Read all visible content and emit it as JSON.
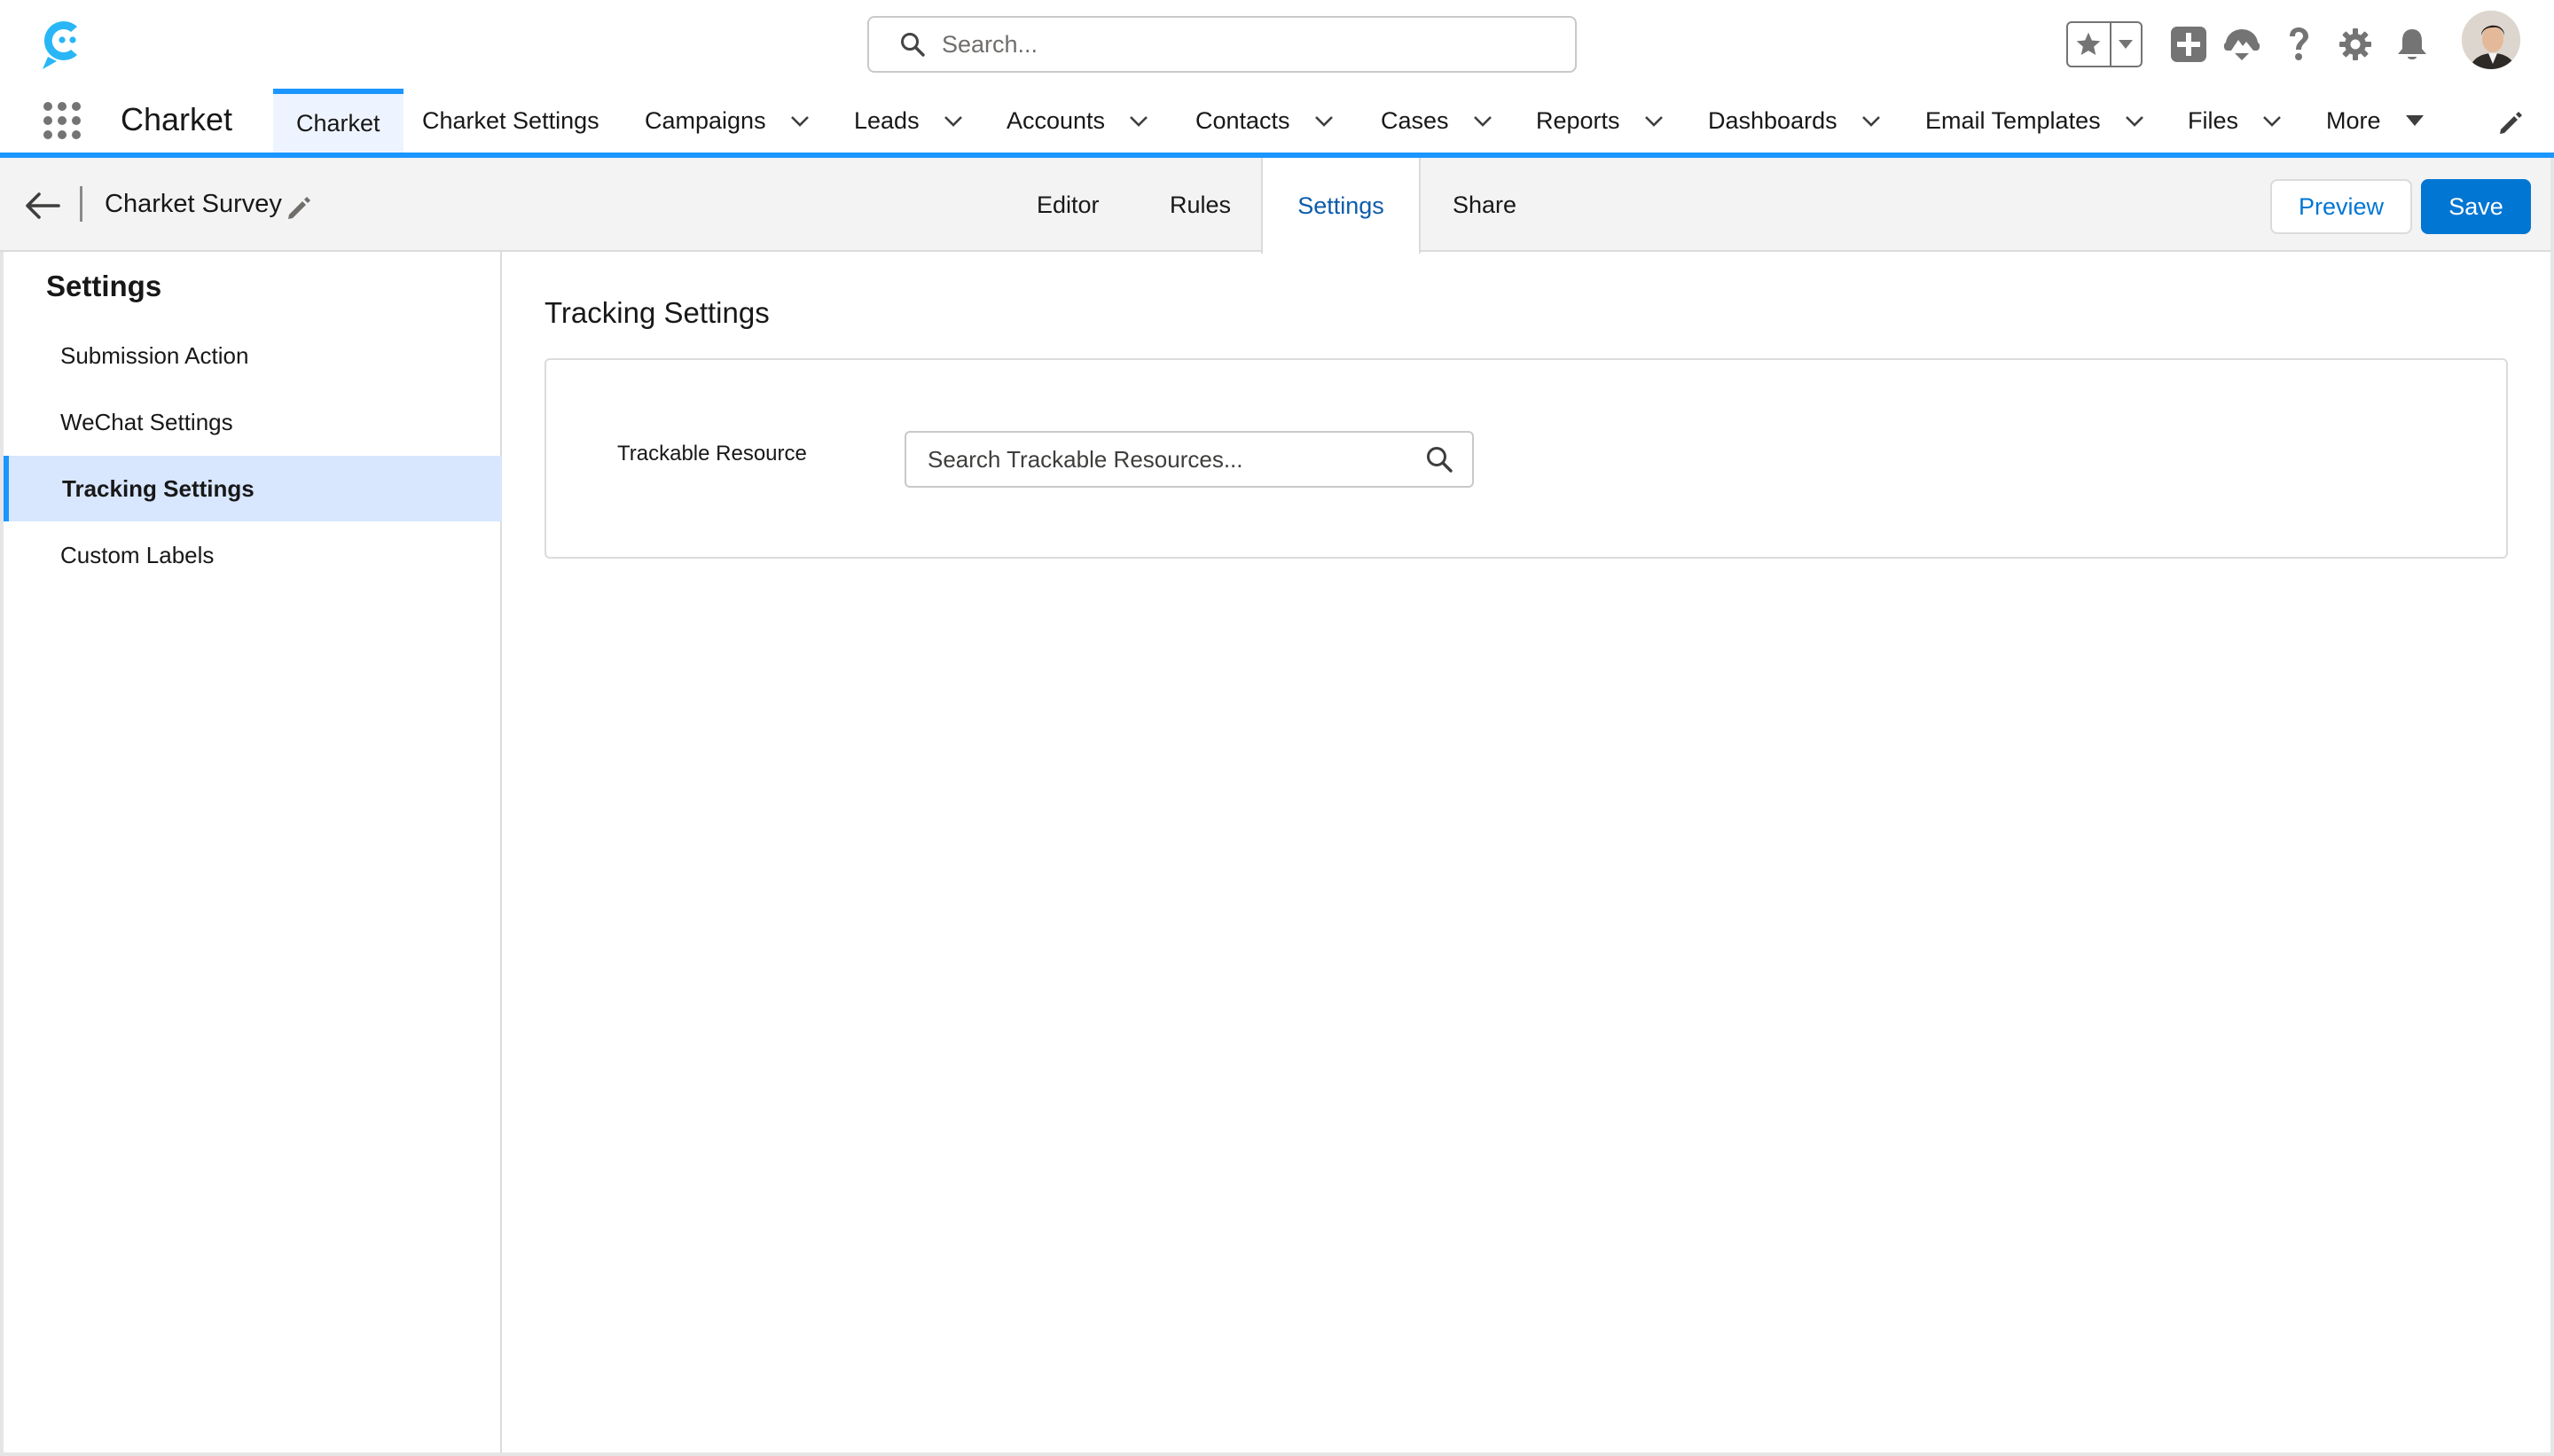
{
  "header": {
    "search_placeholder": "Search..."
  },
  "nav": {
    "app_name": "Charket",
    "items": [
      {
        "label": "Charket",
        "active": true
      },
      {
        "label": "Charket Settings"
      },
      {
        "label": "Campaigns"
      },
      {
        "label": "Leads"
      },
      {
        "label": "Accounts"
      },
      {
        "label": "Contacts"
      },
      {
        "label": "Cases"
      },
      {
        "label": "Reports"
      },
      {
        "label": "Dashboards"
      },
      {
        "label": "Email Templates"
      },
      {
        "label": "Files"
      },
      {
        "label": "More"
      }
    ]
  },
  "builder": {
    "survey_title": "Charket Survey",
    "tabs": [
      {
        "label": "Editor"
      },
      {
        "label": "Rules"
      },
      {
        "label": "Settings",
        "active": true
      },
      {
        "label": "Share"
      }
    ],
    "preview_label": "Preview",
    "save_label": "Save"
  },
  "sidebar": {
    "heading": "Settings",
    "items": [
      {
        "label": "Submission Action"
      },
      {
        "label": "WeChat Settings"
      },
      {
        "label": "Tracking Settings",
        "active": true
      },
      {
        "label": "Custom Labels"
      }
    ]
  },
  "main": {
    "title": "Tracking Settings",
    "field_label": "Trackable Resource",
    "lookup_placeholder": "Search Trackable Resources..."
  },
  "colors": {
    "brand_blue": "#0176d3",
    "accent_blue": "#1b96ff",
    "active_tab_text": "#0b5cab",
    "selected_bg": "#d8e6fe"
  }
}
